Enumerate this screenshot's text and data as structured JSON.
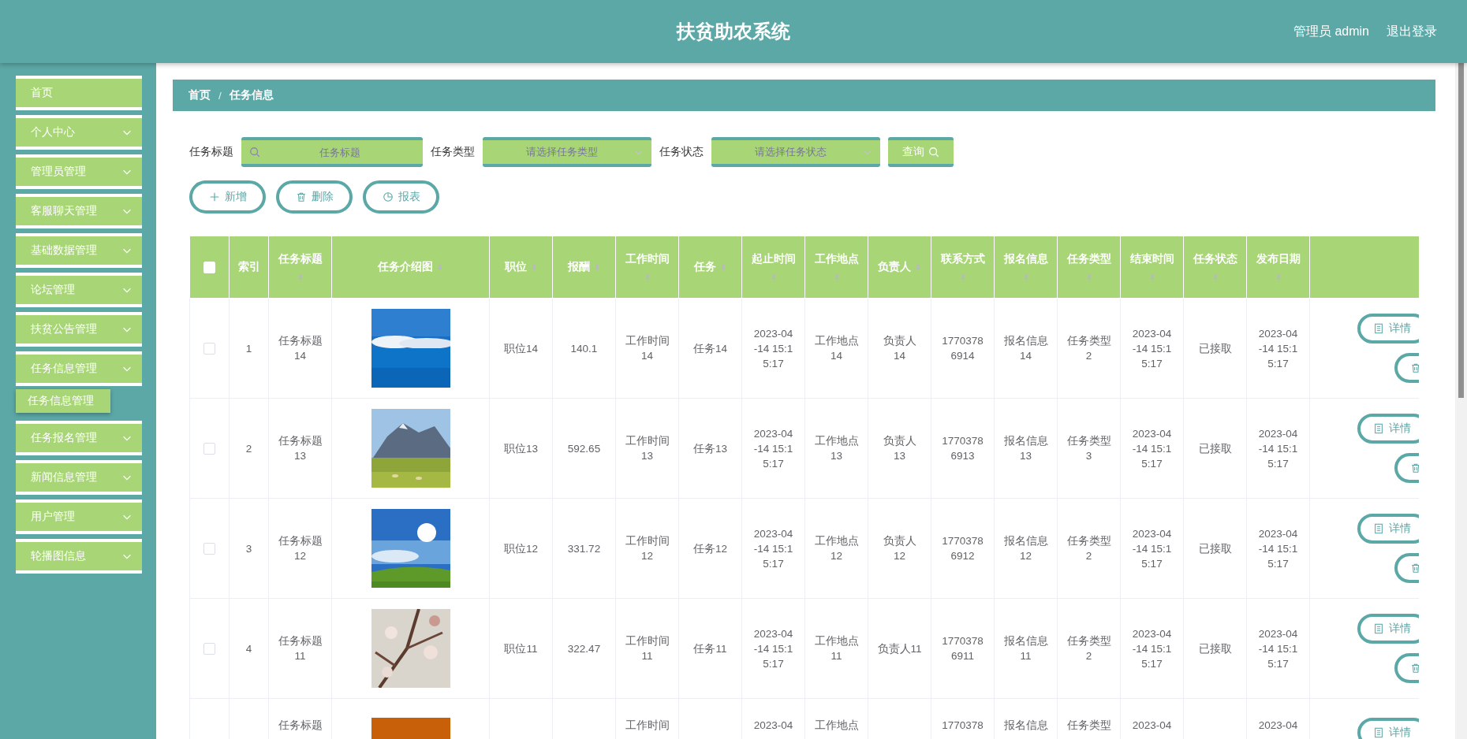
{
  "header": {
    "title": "扶贫助农系统",
    "user": "管理员 admin",
    "logout": "退出登录"
  },
  "sidebar": {
    "items": [
      {
        "label": "首页",
        "kind": "link"
      },
      {
        "label": "个人中心",
        "kind": "menu"
      },
      {
        "label": "管理员管理",
        "kind": "menu"
      },
      {
        "label": "客服聊天管理",
        "kind": "menu"
      },
      {
        "label": "基础数据管理",
        "kind": "menu"
      },
      {
        "label": "论坛管理",
        "kind": "menu"
      },
      {
        "label": "扶贫公告管理",
        "kind": "menu"
      },
      {
        "label": "任务信息管理",
        "kind": "menu",
        "children": [
          {
            "label": "任务信息管理",
            "selected": true
          }
        ]
      },
      {
        "label": "任务报名管理",
        "kind": "menu"
      },
      {
        "label": "新闻信息管理",
        "kind": "menu"
      },
      {
        "label": "用户管理",
        "kind": "menu"
      },
      {
        "label": "轮播图信息",
        "kind": "menu"
      }
    ]
  },
  "breadcrumb": {
    "items": [
      "首页",
      "任务信息"
    ],
    "separator": "/"
  },
  "search": {
    "fields": [
      {
        "label": "任务标题",
        "kind": "input",
        "placeholder": "任务标题"
      },
      {
        "label": "任务类型",
        "kind": "select",
        "placeholder": "请选择任务类型"
      },
      {
        "label": "任务状态",
        "kind": "select",
        "placeholder": "请选择任务状态"
      }
    ],
    "button": "查询"
  },
  "actions": [
    {
      "kind": "add",
      "label": "新增"
    },
    {
      "kind": "delete",
      "label": "删除"
    },
    {
      "kind": "report",
      "label": "报表"
    }
  ],
  "table": {
    "select_all": {
      "checked": false
    },
    "columns": [
      {
        "label": "索引",
        "sortable": false,
        "kind": "text"
      },
      {
        "label": "任务标题",
        "sortable": true,
        "kind": "text"
      },
      {
        "label": "任务介绍图",
        "sortable": true
      },
      {
        "label": "职位",
        "sortable": true,
        "kind": "text"
      },
      {
        "label": "报酬",
        "sortable": true,
        "kind": "text"
      },
      {
        "label": "工作时间",
        "sortable": true,
        "kind": "text"
      },
      {
        "label": "任务",
        "sortable": true,
        "kind": "text"
      },
      {
        "label": "起止时间",
        "sortable": true,
        "kind": "datetime"
      },
      {
        "label": "工作地点",
        "sortable": true,
        "kind": "text"
      },
      {
        "label": "负责人",
        "sortable": true,
        "kind": "text"
      },
      {
        "label": "联系方式",
        "sortable": true,
        "kind": "digits"
      },
      {
        "label": "报名信息",
        "sortable": true,
        "kind": "text"
      },
      {
        "label": "任务类型",
        "sortable": true,
        "kind": "text"
      },
      {
        "label": "结束时间",
        "sortable": true,
        "kind": "datetime"
      },
      {
        "label": "任务状态",
        "sortable": true,
        "kind": "text"
      },
      {
        "label": "发布日期",
        "sortable": true,
        "kind": "datetime"
      },
      {
        "kind": "actions"
      }
    ],
    "rows": [
      {
        "kind": "full",
        "checked": false,
        "cells": [
          {
            "text": "1"
          },
          {
            "text": "任务标题14"
          },
          {
            "kind": "picture"
          },
          {
            "text": "职位14"
          },
          {
            "text": "140.1"
          },
          {
            "text": "工作时间14"
          },
          {
            "text": "任务14"
          },
          {
            "text": "2023-04-14 15:15:17"
          },
          {
            "text": "工作地点14"
          },
          {
            "text": "负责人14"
          },
          {
            "text": "17703786914"
          },
          {
            "text": "报名信息14"
          },
          {
            "text": "任务类型2"
          },
          {
            "text": "2023-04-14 15:15:17"
          },
          {
            "text": "已接取"
          },
          {
            "text": "2023-04-14 15:15:17"
          }
        ],
        "actions": [
          {
            "kind": "detail",
            "label": "详情"
          },
          {
            "kind": "delete"
          }
        ]
      },
      {
        "kind": "full",
        "checked": false,
        "cells": [
          {
            "text": "2"
          },
          {
            "text": "任务标题13"
          },
          {
            "kind": "picture"
          },
          {
            "text": "职位13"
          },
          {
            "text": "592.65"
          },
          {
            "text": "工作时间13"
          },
          {
            "text": "任务13"
          },
          {
            "text": "2023-04-14 15:15:17"
          },
          {
            "text": "工作地点13"
          },
          {
            "text": "负责人13"
          },
          {
            "text": "17703786913"
          },
          {
            "text": "报名信息13"
          },
          {
            "text": "任务类型3"
          },
          {
            "text": "2023-04-14 15:15:17"
          },
          {
            "text": "已接取"
          },
          {
            "text": "2023-04-14 15:15:17"
          }
        ],
        "actions": [
          {
            "kind": "detail",
            "label": "详情"
          },
          {
            "kind": "delete"
          }
        ]
      },
      {
        "kind": "full",
        "checked": false,
        "cells": [
          {
            "text": "3"
          },
          {
            "text": "任务标题12"
          },
          {
            "kind": "picture"
          },
          {
            "text": "职位12"
          },
          {
            "text": "331.72"
          },
          {
            "text": "工作时间12"
          },
          {
            "text": "任务12"
          },
          {
            "text": "2023-04-14 15:15:17"
          },
          {
            "text": "工作地点12"
          },
          {
            "text": "负责人12"
          },
          {
            "text": "17703786912"
          },
          {
            "text": "报名信息12"
          },
          {
            "text": "任务类型2"
          },
          {
            "text": "2023-04-14 15:15:17"
          },
          {
            "text": "已接取"
          },
          {
            "text": "2023-04-14 15:15:17"
          }
        ],
        "actions": [
          {
            "kind": "detail",
            "label": "详情"
          },
          {
            "kind": "delete"
          }
        ]
      },
      {
        "kind": "full",
        "checked": false,
        "cells": [
          {
            "text": "4"
          },
          {
            "text": "任务标题11"
          },
          {
            "kind": "picture"
          },
          {
            "text": "职位11"
          },
          {
            "text": "322.47"
          },
          {
            "text": "工作时间11"
          },
          {
            "text": "任务11"
          },
          {
            "text": "2023-04-14 15:15:17"
          },
          {
            "text": "工作地点11"
          },
          {
            "text": "负责人11"
          },
          {
            "text": "17703786911"
          },
          {
            "text": "报名信息11"
          },
          {
            "text": "任务类型2"
          },
          {
            "text": "2023-04-14 15:15:17"
          },
          {
            "text": "已接取"
          },
          {
            "text": "2023-04-14 15:15:17"
          }
        ],
        "actions": [
          {
            "kind": "detail",
            "label": "详情"
          },
          {
            "kind": "delete"
          }
        ]
      },
      {
        "kind": "partial",
        "cells": [
          {},
          {
            "text": "任务标题"
          },
          {
            "kind": "picture"
          },
          {},
          {},
          {
            "text": "工作时间"
          },
          {},
          {
            "text": "2023-04"
          },
          {
            "text": "工作地点"
          },
          {},
          {
            "text": "1770378"
          },
          {
            "text": "报名信息"
          },
          {
            "text": "任务类型"
          },
          {
            "text": "2023-04"
          },
          {},
          {
            "text": "2023-04"
          }
        ],
        "actions": [
          {
            "kind": "detail",
            "label": "详情"
          }
        ]
      }
    ]
  }
}
